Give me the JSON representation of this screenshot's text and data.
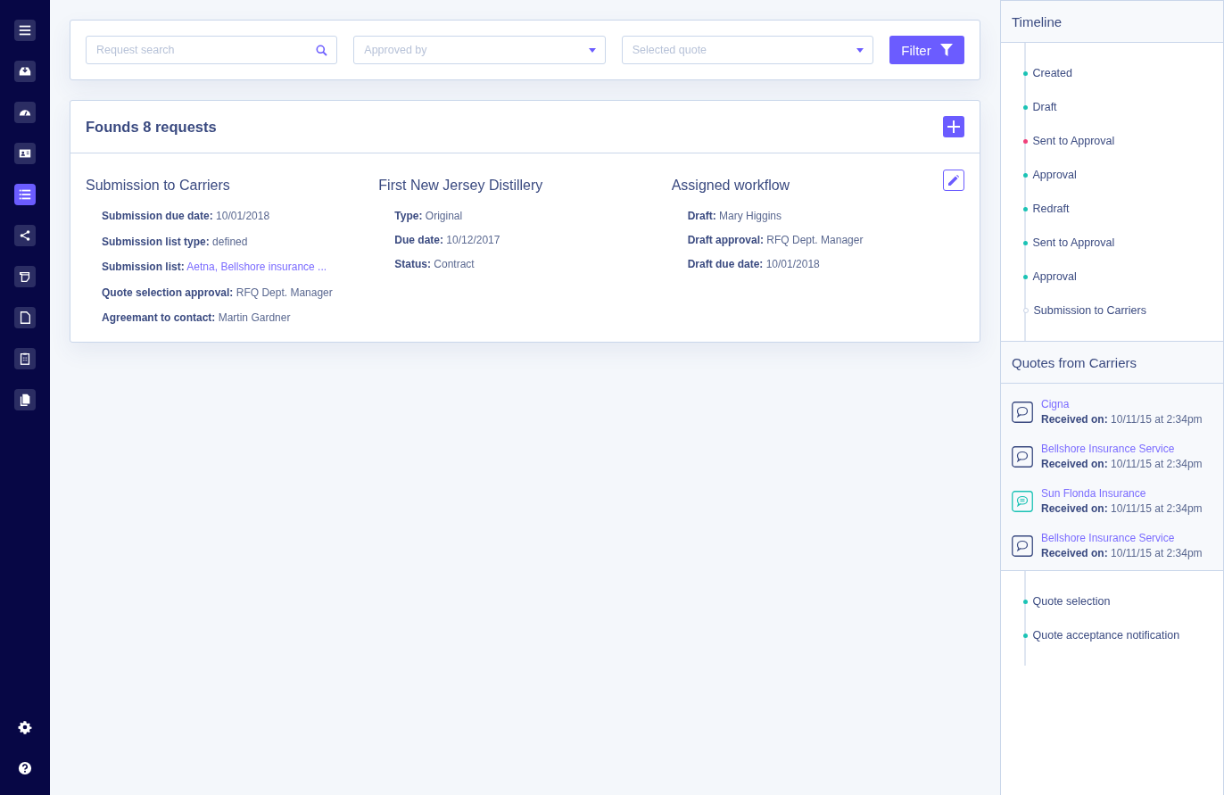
{
  "sidebar": {
    "items": [
      {
        "selected": false
      },
      {
        "selected": false
      },
      {
        "selected": false
      },
      {
        "selected": false
      },
      {
        "selected": true
      },
      {
        "selected": false
      },
      {
        "selected": false
      },
      {
        "selected": false
      },
      {
        "selected": false
      },
      {
        "selected": false
      }
    ]
  },
  "filters": {
    "search": {
      "placeholder": "Request search"
    },
    "approved_by": {
      "placeholder": "Approved by"
    },
    "selected_quote": {
      "placeholder": "Selected quote"
    },
    "filter_button": "Filter"
  },
  "results": {
    "title": "Founds 8 requests",
    "columns": [
      {
        "title": "Submission to Carriers",
        "fields": [
          {
            "label": "Submission due date:",
            "value": "10/01/2018",
            "kind": "text"
          },
          {
            "label": "Submission list type:",
            "value": "defined",
            "kind": "text"
          },
          {
            "label": "Submission list:",
            "value": "Aetna, Bellshore insurance ...",
            "kind": "link"
          },
          {
            "label": "Quote selection approval:",
            "value": "RFQ Dept. Manager",
            "kind": "text"
          },
          {
            "label": "Agreemant to contact:",
            "value": "Martin Gardner",
            "kind": "text"
          }
        ]
      },
      {
        "title": "First New Jersey Distillery",
        "fields": [
          {
            "label": "Type:",
            "value": "Original",
            "kind": "text"
          },
          {
            "label": "Due date:",
            "value": "10/12/2017",
            "kind": "text"
          },
          {
            "label": "Status:",
            "value": "Contract",
            "kind": "text"
          }
        ]
      },
      {
        "title": "Assigned workflow",
        "fields": [
          {
            "label": "Draft:",
            "value": "Mary Higgins",
            "kind": "text"
          },
          {
            "label": "Draft approval:",
            "value": "RFQ Dept. Manager",
            "kind": "text"
          },
          {
            "label": "Draft due date:",
            "value": "10/01/2018",
            "kind": "text"
          }
        ]
      }
    ]
  },
  "timeline": {
    "title": "Timeline",
    "items": [
      {
        "label": "Created",
        "completed": true,
        "color": "#1bc3b5"
      },
      {
        "label": "Draft",
        "completed": true,
        "color": "#1bc3b5"
      },
      {
        "label": "Sent to Approval",
        "completed": true,
        "color": "#f0407a"
      },
      {
        "label": "Approval",
        "completed": true,
        "color": "#1bc3b5"
      },
      {
        "label": "Redraft",
        "completed": true,
        "color": "#1bc3b5"
      },
      {
        "label": "Sent to Approval",
        "completed": true,
        "color": "#1bc3b5"
      },
      {
        "label": "Approval",
        "completed": true,
        "color": "#1bc3b5"
      },
      {
        "label": "Submission to Carriers",
        "completed": false,
        "color": "#c8d3e6"
      }
    ]
  },
  "quotes": {
    "title": "Quotes from Carriers",
    "items": [
      {
        "carrier": "Cigna",
        "received_label": "Received on:",
        "received": "10/11/15 at 2:34pm",
        "highlighted": false
      },
      {
        "carrier": "Bellshore Insurance Service",
        "received_label": "Received on:",
        "received": "10/11/15 at 2:34pm",
        "highlighted": false
      },
      {
        "carrier": "Sun Flonda Insurance",
        "received_label": "Received on:",
        "received": "10/11/15 at 2:34pm",
        "highlighted": true
      },
      {
        "carrier": "Bellshore Insurance Service",
        "received_label": "Received on:",
        "received": "10/11/15 at 2:34pm",
        "highlighted": false
      }
    ]
  },
  "next_steps": {
    "items": [
      {
        "label": "Quote selection",
        "completed": true,
        "color": "#1bc3b5"
      },
      {
        "label": "Quote acceptance notification",
        "completed": true,
        "color": "#1bc3b5"
      }
    ]
  }
}
